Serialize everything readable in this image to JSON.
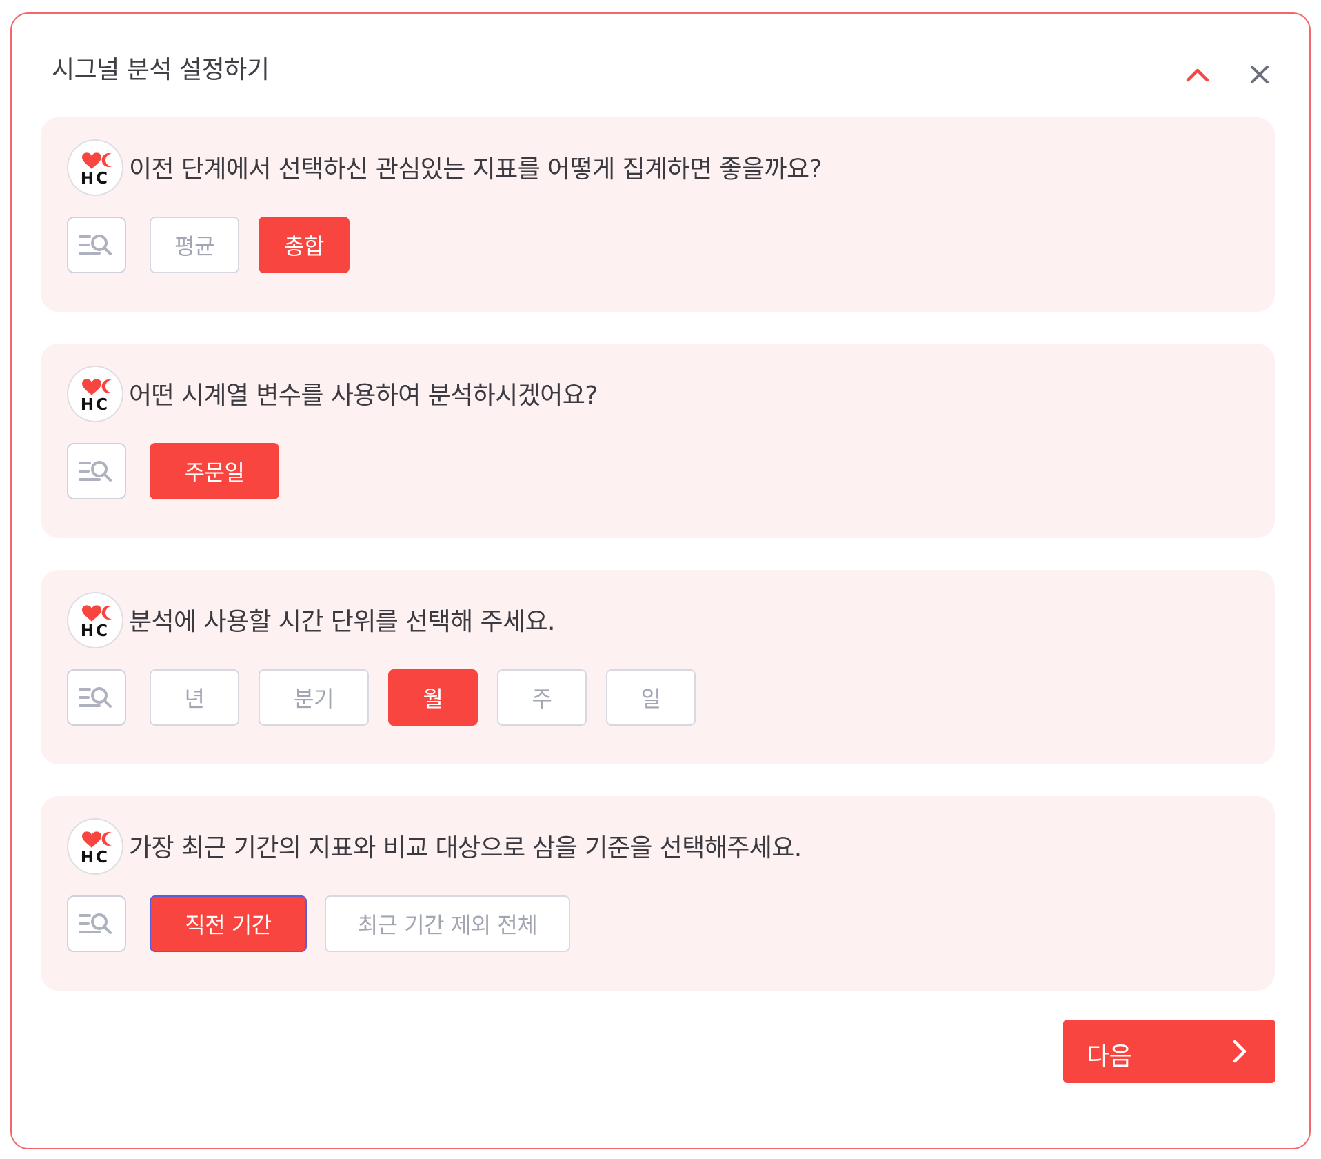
{
  "header": {
    "title": "시그널 분석 설정하기",
    "collapse_icon": "chevron-up-icon",
    "close_icon": "close-icon"
  },
  "brand": {
    "avatar_text": "HC",
    "accent": "#f9453f",
    "dark": "#111111"
  },
  "cards": [
    {
      "question": "이전 단계에서 선택하신 관심있는 지표를 어떻게 집계하면 좋을까요?",
      "options": [
        {
          "label": "평균",
          "selected": false
        },
        {
          "label": "총합",
          "selected": true
        }
      ]
    },
    {
      "question": "어떤 시계열 변수를 사용하여 분석하시겠어요?",
      "options": [
        {
          "label": "주문일",
          "selected": true
        }
      ]
    },
    {
      "question": "분석에 사용할 시간 단위를 선택해 주세요.",
      "options": [
        {
          "label": "년",
          "selected": false
        },
        {
          "label": "분기",
          "selected": false
        },
        {
          "label": "월",
          "selected": true
        },
        {
          "label": "주",
          "selected": false
        },
        {
          "label": "일",
          "selected": false
        }
      ]
    },
    {
      "question": "가장 최근 기간의 지표와 비교 대상으로 삼을 기준을 선택해주세요.",
      "options": [
        {
          "label": "직전 기간",
          "selected": true,
          "focused": true
        },
        {
          "label": "최근 기간 제외 전체",
          "selected": false
        }
      ]
    }
  ],
  "footer": {
    "next_label": "다음",
    "next_icon": "chevron-right-icon"
  },
  "colors": {
    "border": "#f2676a",
    "card_bg": "#fdf1f1",
    "selected": "#f9453f",
    "unselected_text": "#a2a5b2"
  }
}
